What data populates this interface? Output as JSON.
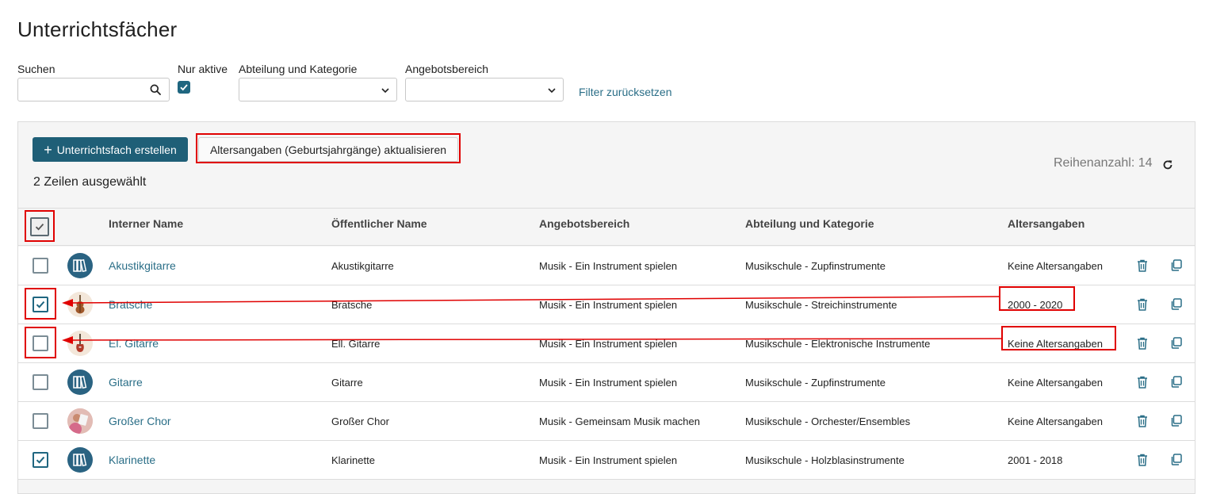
{
  "page": {
    "title": "Unterrichtsfächer"
  },
  "filters": {
    "search_label": "Suchen",
    "search_value": "",
    "only_active_label": "Nur aktive",
    "only_active_checked": true,
    "department_label": "Abteilung und Kategorie",
    "department_value": "",
    "offer_area_label": "Angebotsbereich",
    "offer_area_value": "",
    "reset_label": "Filter zurücksetzen"
  },
  "toolbar": {
    "create_label": "Unterrichtsfach erstellen",
    "update_ages_label": "Altersangaben (Geburtsjahrgänge) aktualisieren",
    "selected_text": "2 Zeilen ausgewählt",
    "row_count_text": "Reihenanzahl: 14"
  },
  "table": {
    "columns": [
      "Interner Name",
      "Öffentlicher Name",
      "Angebotsbereich",
      "Abteilung und Kategorie",
      "Altersangaben"
    ],
    "rows": [
      {
        "internal": "Akustikgitarre",
        "public": "Akustikgitarre",
        "offer": "Musik - Ein Instrument spielen",
        "dept": "Musikschule - Zupfinstrumente",
        "ages": "Keine Altersangaben",
        "checked": false,
        "avatar": "book-icon"
      },
      {
        "internal": "Bratsche",
        "public": "Bratsche",
        "offer": "Musik - Ein Instrument spielen",
        "dept": "Musikschule - Streichinstrumente",
        "ages": "2000 - 2020",
        "checked": true,
        "avatar": "viola-icon"
      },
      {
        "internal": "El. Gitarre",
        "public": "Ell. Gitarre",
        "offer": "Musik - Ein Instrument spielen",
        "dept": "Musikschule - Elektronische Instrumente",
        "ages": "Keine Altersangaben",
        "checked": false,
        "avatar": "electric-guitar-icon"
      },
      {
        "internal": "Gitarre",
        "public": "Gitarre",
        "offer": "Musik - Ein Instrument spielen",
        "dept": "Musikschule - Zupfinstrumente",
        "ages": "Keine Altersangaben",
        "checked": false,
        "avatar": "book-icon"
      },
      {
        "internal": "Großer Chor",
        "public": "Großer Chor",
        "offer": "Musik - Gemeinsam Musik machen",
        "dept": "Musikschule - Orchester/Ensembles",
        "ages": "Keine Altersangaben",
        "checked": false,
        "avatar": "choir-photo"
      },
      {
        "internal": "Klarinette",
        "public": "Klarinette",
        "offer": "Musik - Ein Instrument spielen",
        "dept": "Musikschule - Holzblasinstrumente",
        "ages": "2001 - 2018",
        "checked": true,
        "avatar": "book-icon"
      }
    ]
  },
  "colors": {
    "accent": "#1f5f77",
    "link": "#2a6e87",
    "annotation": "#e00000"
  }
}
